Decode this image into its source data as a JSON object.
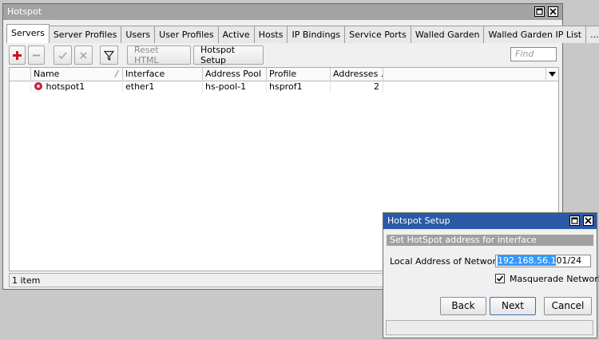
{
  "main_window": {
    "title": "Hotspot",
    "tabs": [
      {
        "label": "Servers"
      },
      {
        "label": "Server Profiles"
      },
      {
        "label": "Users"
      },
      {
        "label": "User Profiles"
      },
      {
        "label": "Active"
      },
      {
        "label": "Hosts"
      },
      {
        "label": "IP Bindings"
      },
      {
        "label": "Service Ports"
      },
      {
        "label": "Walled Garden"
      },
      {
        "label": "Walled Garden IP List"
      },
      {
        "label": "..."
      }
    ],
    "toolbar": {
      "reset_html_label": "Reset HTML",
      "hotspot_setup_label": "Hotspot Setup",
      "find_placeholder": "Find"
    },
    "table": {
      "columns": [
        "Name",
        "Interface",
        "Address Pool",
        "Profile",
        "Addresses ..."
      ],
      "sort_indicator": "/",
      "rows": [
        {
          "name": "hotspot1",
          "interface": "ether1",
          "address_pool": "hs-pool-1",
          "profile": "hsprof1",
          "addresses": "2"
        }
      ]
    },
    "status": "1 item"
  },
  "setup_dialog": {
    "title": "Hotspot Setup",
    "subtitle": "Set HotSpot address for interface",
    "local_address_label": "Local Address of Network:",
    "local_address_selected": "192.168.56.1",
    "local_address_rest": "01/24",
    "masquerade_label": "Masquerade Network",
    "masquerade_checked": true,
    "back_label": "Back",
    "next_label": "Next",
    "cancel_label": "Cancel"
  }
}
